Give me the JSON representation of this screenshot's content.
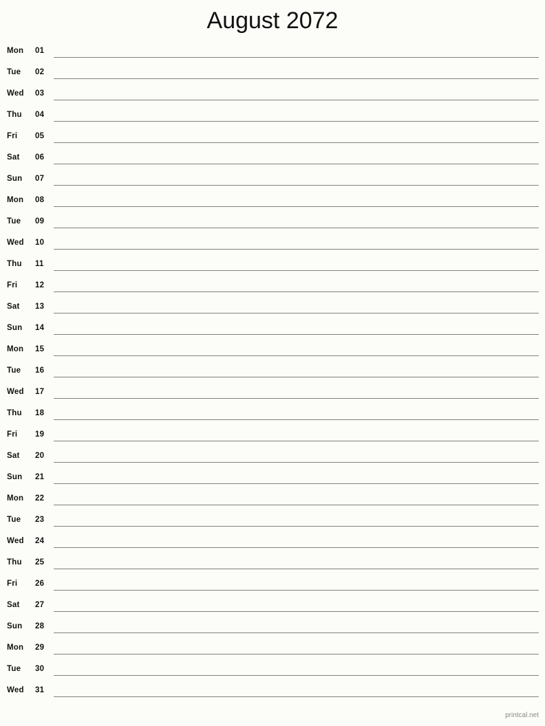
{
  "document": {
    "title": "August 2072",
    "month": "August",
    "year": "2072"
  },
  "colors": {
    "background": "#fcfcf8",
    "text": "#111111",
    "rule": "#808080",
    "footer_text": "#8a8a8a"
  },
  "calendar": {
    "days": [
      {
        "weekday": "Mon",
        "date": "01"
      },
      {
        "weekday": "Tue",
        "date": "02"
      },
      {
        "weekday": "Wed",
        "date": "03"
      },
      {
        "weekday": "Thu",
        "date": "04"
      },
      {
        "weekday": "Fri",
        "date": "05"
      },
      {
        "weekday": "Sat",
        "date": "06"
      },
      {
        "weekday": "Sun",
        "date": "07"
      },
      {
        "weekday": "Mon",
        "date": "08"
      },
      {
        "weekday": "Tue",
        "date": "09"
      },
      {
        "weekday": "Wed",
        "date": "10"
      },
      {
        "weekday": "Thu",
        "date": "11"
      },
      {
        "weekday": "Fri",
        "date": "12"
      },
      {
        "weekday": "Sat",
        "date": "13"
      },
      {
        "weekday": "Sun",
        "date": "14"
      },
      {
        "weekday": "Mon",
        "date": "15"
      },
      {
        "weekday": "Tue",
        "date": "16"
      },
      {
        "weekday": "Wed",
        "date": "17"
      },
      {
        "weekday": "Thu",
        "date": "18"
      },
      {
        "weekday": "Fri",
        "date": "19"
      },
      {
        "weekday": "Sat",
        "date": "20"
      },
      {
        "weekday": "Sun",
        "date": "21"
      },
      {
        "weekday": "Mon",
        "date": "22"
      },
      {
        "weekday": "Tue",
        "date": "23"
      },
      {
        "weekday": "Wed",
        "date": "24"
      },
      {
        "weekday": "Thu",
        "date": "25"
      },
      {
        "weekday": "Fri",
        "date": "26"
      },
      {
        "weekday": "Sat",
        "date": "27"
      },
      {
        "weekday": "Sun",
        "date": "28"
      },
      {
        "weekday": "Mon",
        "date": "29"
      },
      {
        "weekday": "Tue",
        "date": "30"
      },
      {
        "weekday": "Wed",
        "date": "31"
      }
    ]
  },
  "footer": {
    "brand": "printcal.net"
  }
}
